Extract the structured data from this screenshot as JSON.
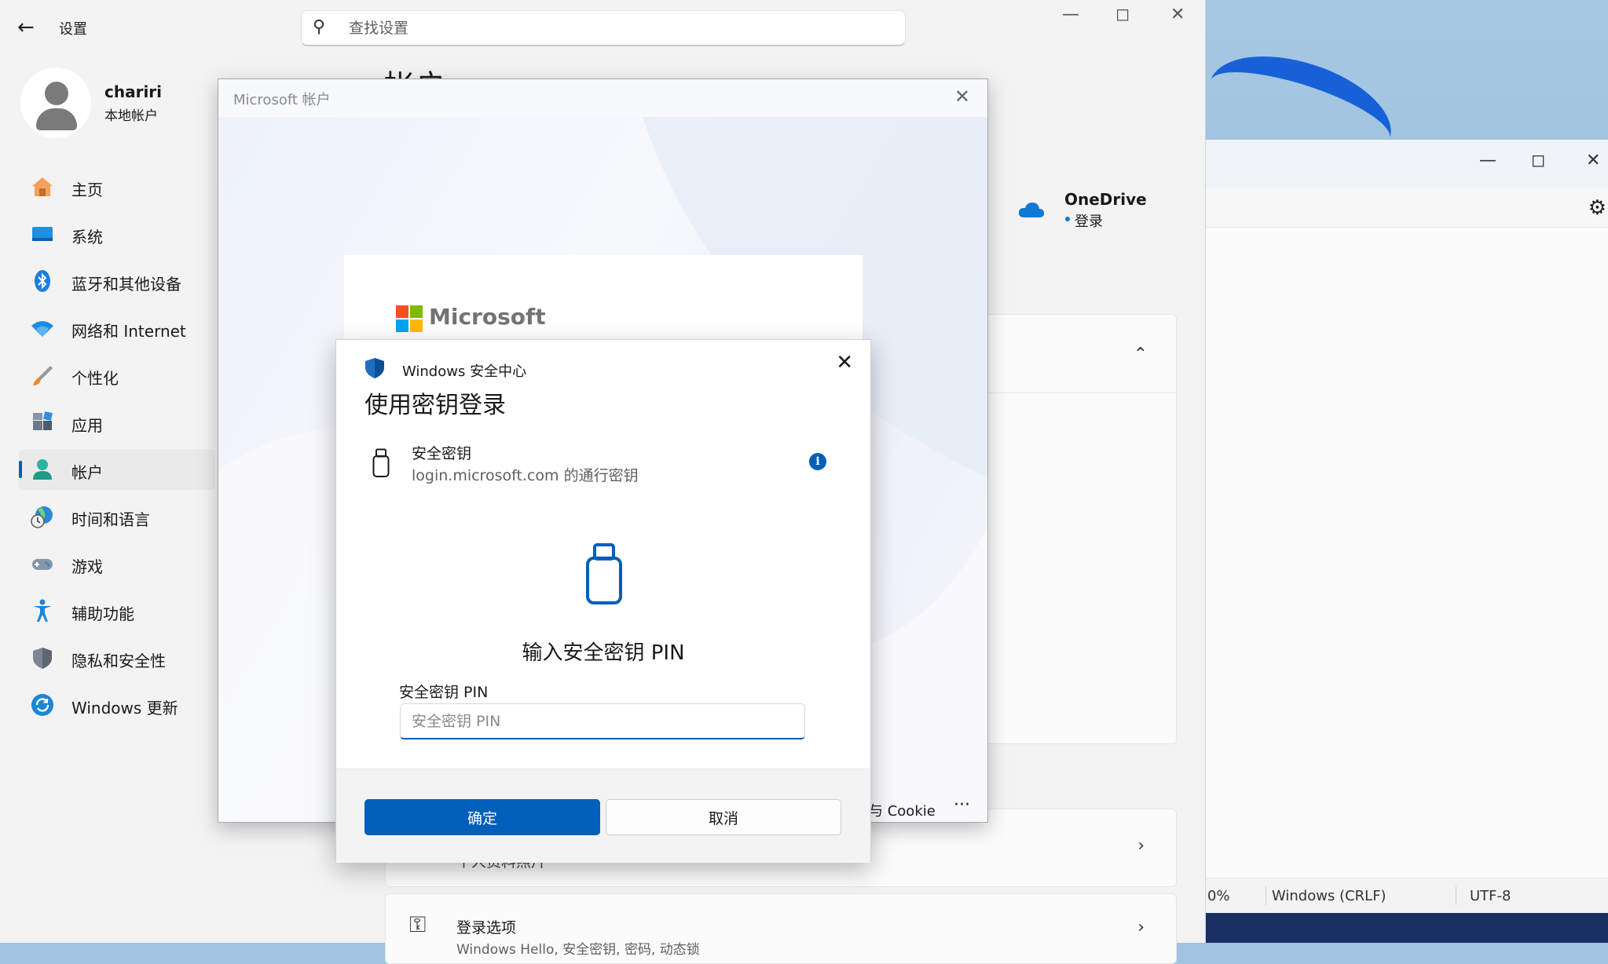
{
  "settings": {
    "app_title": "设置",
    "search_placeholder": "查找设置",
    "user": {
      "name": "chariri",
      "account_type": "本地帐户"
    },
    "nav": [
      {
        "label": "主页",
        "icon": "home-icon"
      },
      {
        "label": "系统",
        "icon": "display-icon"
      },
      {
        "label": "蓝牙和其他设备",
        "icon": "bluetooth-icon"
      },
      {
        "label": "网络和 Internet",
        "icon": "wifi-icon"
      },
      {
        "label": "个性化",
        "icon": "brush-icon"
      },
      {
        "label": "应用",
        "icon": "apps-icon"
      },
      {
        "label": "帐户",
        "icon": "person-icon",
        "active": true
      },
      {
        "label": "时间和语言",
        "icon": "globe-clock-icon"
      },
      {
        "label": "游戏",
        "icon": "gamepad-icon"
      },
      {
        "label": "辅助功能",
        "icon": "accessibility-icon"
      },
      {
        "label": "隐私和安全性",
        "icon": "shield-icon"
      },
      {
        "label": "Windows 更新",
        "icon": "update-icon"
      }
    ],
    "page_title_fragment": "帐户",
    "onedrive": {
      "name": "OneDrive",
      "status": "登录"
    },
    "cards": {
      "profile_text_fragment": "个人资料照片",
      "signin_options": "登录选项",
      "signin_sub_fragment": "Windows Hello, 安全密钥, 密码, 动态锁"
    }
  },
  "ms_dialog": {
    "title": "Microsoft 帐户",
    "brand": "Microsoft",
    "footer_link_fragment": "与 Cookie",
    "more": "···"
  },
  "security_dialog": {
    "app_name": "Windows 安全中心",
    "heading": "使用密钥登录",
    "key_title": "安全密钥",
    "key_subtitle": "login.microsoft.com 的通行密钥",
    "pin_heading": "输入安全密钥 PIN",
    "pin_label": "安全密钥 PIN",
    "pin_placeholder": "安全密钥 PIN",
    "ok_label": "确定",
    "cancel_label": "取消"
  },
  "notepad": {
    "status_zoom": "0%",
    "status_eol": "Windows (CRLF)",
    "status_encoding": "UTF-8"
  },
  "colors": {
    "accent": "#005fb8",
    "onedrive": "#0f78d4"
  }
}
